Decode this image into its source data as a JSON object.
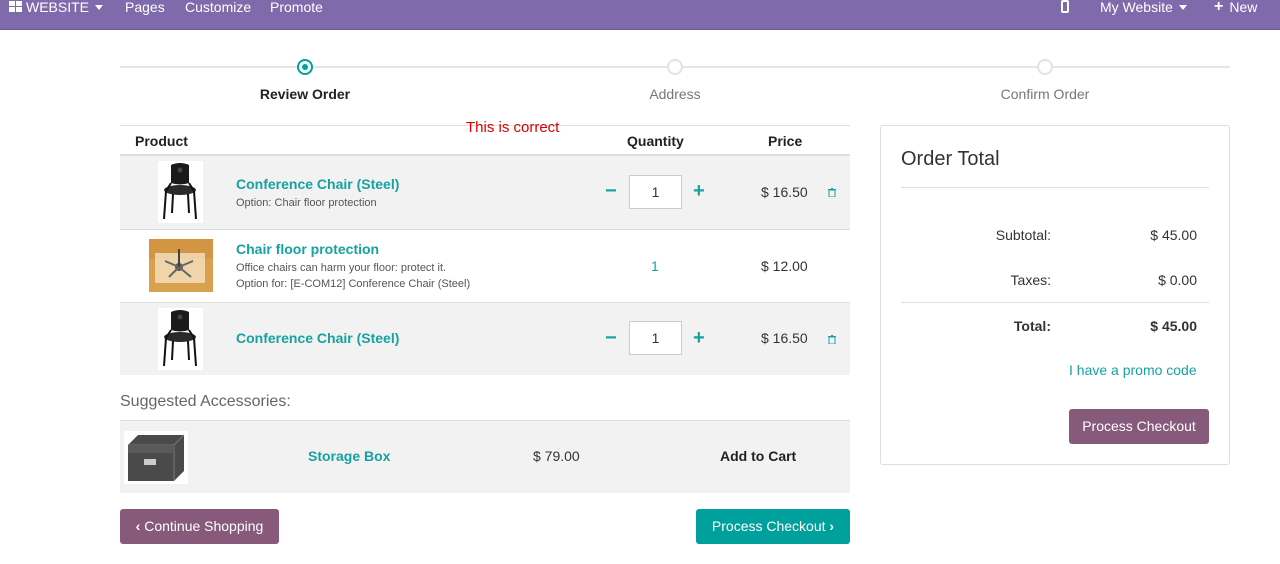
{
  "topbar": {
    "website_label": "WEBSITE",
    "menu": [
      "Pages",
      "Customize",
      "Promote"
    ],
    "site_selector": "My Website",
    "new_label": "New"
  },
  "wizard": {
    "steps": [
      "Review Order",
      "Address",
      "Confirm Order"
    ],
    "active_step": "Review Order"
  },
  "annotation": "This is correct",
  "cart": {
    "headers": {
      "product": "Product",
      "quantity": "Quantity",
      "price": "Price"
    },
    "rows": [
      {
        "name": "Conference Chair (Steel)",
        "desc": "Option: Chair floor protection",
        "desc2": "",
        "quantity": "1",
        "price": "$ 16.50",
        "image": "chair-image"
      },
      {
        "name": "Chair floor protection",
        "desc": "Office chairs can harm your floor: protect it.",
        "desc2": "Option for: [E-COM12] Conference Chair (Steel)",
        "quantity": "1",
        "price": "$ 12.00",
        "image": "floor-protection-image"
      },
      {
        "name": "Conference Chair (Steel)",
        "desc": "",
        "desc2": "",
        "quantity": "1",
        "price": "$ 16.50",
        "image": "chair-image"
      }
    ]
  },
  "suggested": {
    "title": "Suggested Accessories:",
    "items": [
      {
        "name": "Storage Box",
        "price": "$ 79.00",
        "action": "Add to Cart"
      }
    ]
  },
  "buttons": {
    "continue_shopping": "Continue Shopping",
    "process_checkout": "Process Checkout"
  },
  "order_total": {
    "title": "Order Total",
    "subtotal_label": "Subtotal:",
    "subtotal": "$ 45.00",
    "taxes_label": "Taxes:",
    "taxes": "$ 0.00",
    "total_label": "Total:",
    "total": "$ 45.00",
    "promo_link": "I have a promo code",
    "checkout_button": "Process Checkout"
  },
  "colors": {
    "topbar": "#7f6aac",
    "teal": "#00a09d",
    "purple": "#875a7b"
  }
}
